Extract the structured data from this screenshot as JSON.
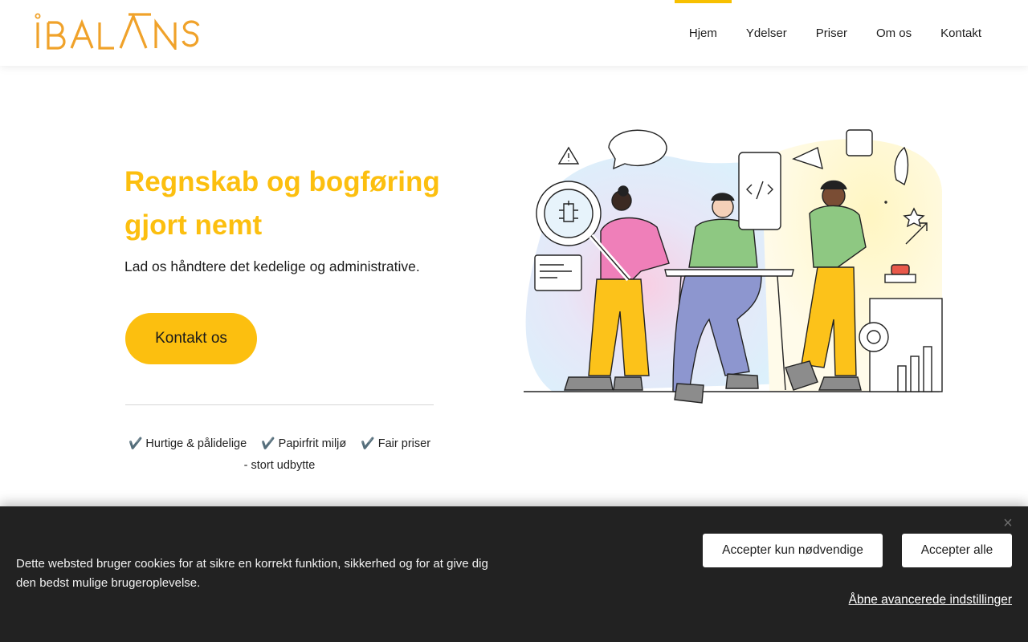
{
  "brand": {
    "logo_text": "iBALANS",
    "accent": "#fcbf0f"
  },
  "nav": {
    "items": [
      {
        "label": "Hjem",
        "active": true
      },
      {
        "label": "Ydelser",
        "active": false
      },
      {
        "label": "Priser",
        "active": false
      },
      {
        "label": "Om os",
        "active": false
      },
      {
        "label": "Kontakt",
        "active": false
      }
    ]
  },
  "hero": {
    "title": "Regnskab og bogføring gjort nemt",
    "subtitle": "Lad os håndtere det kedelige og administrative.",
    "cta_label": "Kontakt os",
    "features": [
      {
        "icon": "check-icon",
        "glyph": "✔️",
        "label": "Hurtige & pålidelige"
      },
      {
        "icon": "check-icon",
        "glyph": "✔️",
        "label": "Papirfrit miljø"
      },
      {
        "icon": "check-icon",
        "glyph": "✔️",
        "label": "Fair priser - stort udbytte"
      }
    ]
  },
  "cookie": {
    "text": "Dette websted bruger cookies for at sikre en korrekt funktion, sikkerhed og for at give dig den bedst mulige brugeroplevelse.",
    "accept_necessary": "Accepter kun nødvendige",
    "accept_all": "Accepter alle",
    "advanced": "Åbne avancerede indstillinger",
    "close_glyph": "×"
  }
}
